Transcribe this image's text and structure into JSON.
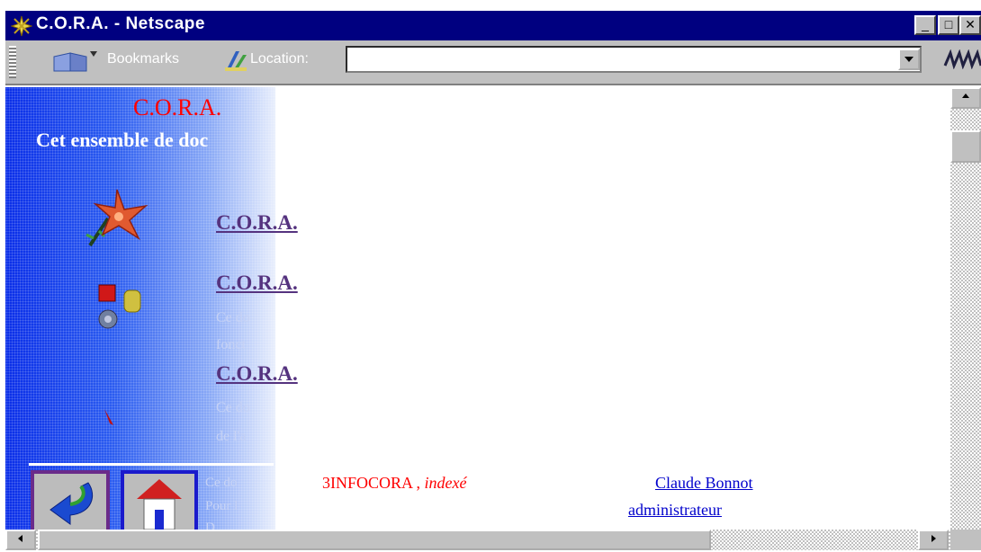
{
  "window": {
    "title": "C.O.R.A. - Netscape",
    "minimize_glyph": "_",
    "maximize_glyph": "□",
    "close_glyph": "✕"
  },
  "toolbar": {
    "bookmarks_label": "Bookmarks",
    "location_label": "Location:",
    "location_value": ""
  },
  "page": {
    "heading": "C.O.R.A.",
    "subtitle_visible": "Cet ensemble de doc",
    "links": [
      {
        "label": "C.O.R.A."
      },
      {
        "label": "C.O.R.A."
      },
      {
        "label": "C.O.R.A."
      }
    ],
    "descriptions": [
      "Ce do",
      "fonct",
      "Ce do",
      "de l'a"
    ],
    "footer_notes": [
      "Ce do",
      "Pour l",
      "D"
    ],
    "infocora_code": "3INFOCORA ,",
    "infocora_indexed": "indexé",
    "author_link": "Claude Bonnot",
    "admin_link": "administrateur"
  },
  "icons": {
    "app": "netscape-app-icon",
    "bookmarks": "bookmarks-icon",
    "location": "location-icon",
    "back": "back-arrow-icon",
    "home": "home-icon"
  },
  "colors": {
    "titlebar": "#000080",
    "chrome": "#c0c0c0",
    "heading": "#ff0000",
    "visited_link": "#55337f",
    "link": "#0000cc",
    "gradient_start": "#0a2ee8"
  }
}
